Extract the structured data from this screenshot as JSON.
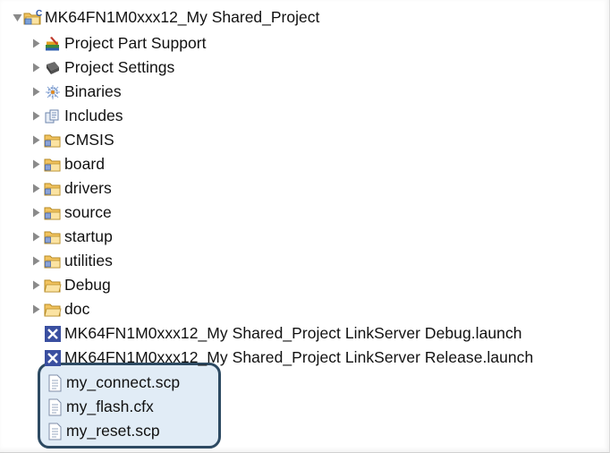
{
  "tree": {
    "root": {
      "label": "MK64FN1M0xxx12_My Shared_Project",
      "icon": "c-project-folder-icon",
      "expanded": true
    },
    "items": [
      {
        "label": "Project Part Support",
        "icon": "books-icon",
        "expandable": true
      },
      {
        "label": "Project Settings",
        "icon": "settings-chip-icon",
        "expandable": true
      },
      {
        "label": "Binaries",
        "icon": "binaries-icon",
        "expandable": true
      },
      {
        "label": "Includes",
        "icon": "includes-icon",
        "expandable": true
      },
      {
        "label": "CMSIS",
        "icon": "source-folder-icon",
        "expandable": true
      },
      {
        "label": "board",
        "icon": "source-folder-icon",
        "expandable": true
      },
      {
        "label": "drivers",
        "icon": "source-folder-icon",
        "expandable": true
      },
      {
        "label": "source",
        "icon": "source-folder-icon",
        "expandable": true
      },
      {
        "label": "startup",
        "icon": "source-folder-icon",
        "expandable": true
      },
      {
        "label": "utilities",
        "icon": "source-folder-icon",
        "expandable": true
      },
      {
        "label": "Debug",
        "icon": "folder-icon",
        "expandable": true
      },
      {
        "label": "doc",
        "icon": "folder-icon",
        "expandable": true
      },
      {
        "label": "MK64FN1M0xxx12_My Shared_Project LinkServer Debug.launch",
        "icon": "launch-file-icon",
        "expandable": false
      },
      {
        "label": "MK64FN1M0xxx12_My Shared_Project LinkServer Release.launch",
        "icon": "launch-file-icon",
        "expandable": false
      },
      {
        "label": "my_connect.scp",
        "icon": "text-file-icon",
        "expandable": false
      },
      {
        "label": "my_flash.cfx",
        "icon": "text-file-icon",
        "expandable": false
      },
      {
        "label": "my_reset.scp",
        "icon": "text-file-icon",
        "expandable": false
      }
    ]
  },
  "highlight": {
    "covers": [
      "my_connect.scp",
      "my_flash.cfx",
      "my_reset.scp"
    ],
    "border_color": "#2d4a62",
    "fill_color": "#e1ecf6"
  },
  "colors": {
    "folder": "#e8b548",
    "folder_src_overlay": "#6f86c4",
    "launch": "#3a4fa0",
    "twistie": "#8a8a8a"
  }
}
